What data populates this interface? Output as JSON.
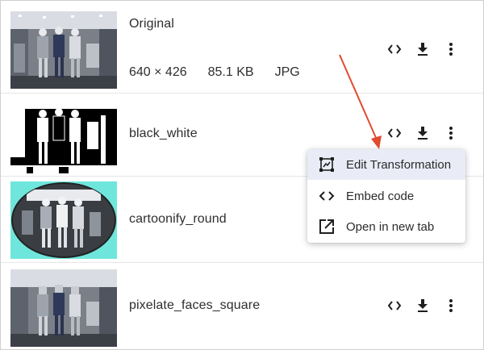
{
  "items": [
    {
      "name": "Original",
      "meta": {
        "dimensions": "640 × 426",
        "size": "85.1 KB",
        "format": "JPG"
      }
    },
    {
      "name": "black_white"
    },
    {
      "name": "cartoonify_round"
    },
    {
      "name": "pixelate_faces_square"
    }
  ],
  "actions": {
    "code_icon": "code-icon",
    "download_icon": "download-icon",
    "more_icon": "more-vertical-icon"
  },
  "menu": {
    "items": [
      {
        "label": "Edit Transformation",
        "icon": "transform-icon"
      },
      {
        "label": "Embed code",
        "icon": "code-icon"
      },
      {
        "label": "Open in new tab",
        "icon": "open-new-tab-icon"
      }
    ]
  },
  "colors": {
    "annotation_arrow": "#e2492f",
    "cartoon_bg": "#6fe6dc",
    "menu_highlight": "#e9ecf6"
  }
}
